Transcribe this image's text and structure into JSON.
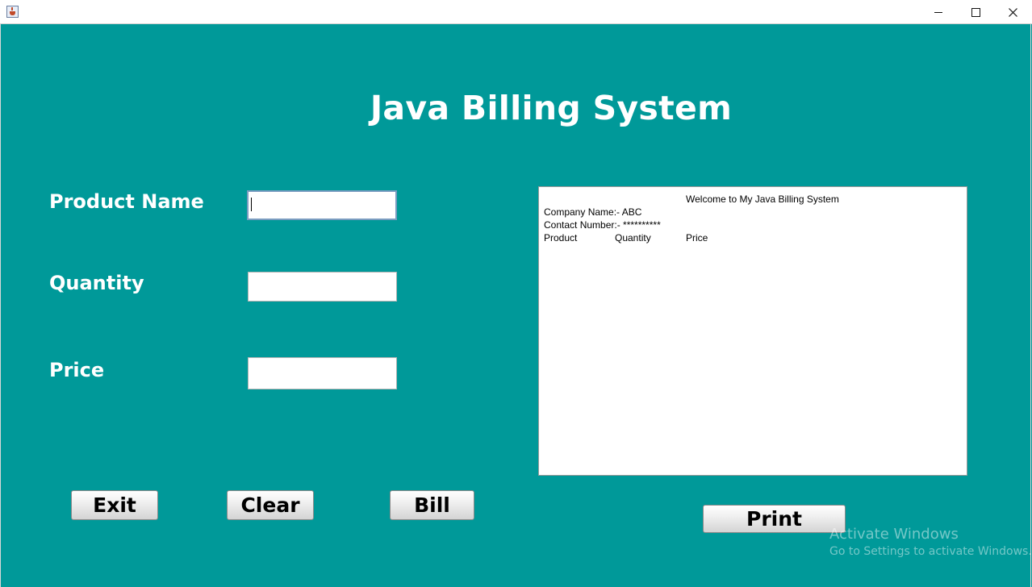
{
  "window": {
    "title": "",
    "controls": {
      "minimize": "minimize-icon",
      "maximize": "maximize-icon",
      "close": "close-icon"
    }
  },
  "heading": "Java Billing System",
  "form": {
    "product_name_label": "Product Name",
    "product_name_value": "",
    "quantity_label": "Quantity",
    "quantity_value": "",
    "price_label": "Price",
    "price_value": ""
  },
  "buttons": {
    "exit": "Exit",
    "clear": "Clear",
    "bill": "Bill",
    "print": "Print"
  },
  "receipt": {
    "welcome": "Welcome to My Java Billing System",
    "company": "Company Name:- ABC",
    "contact": "Contact Number:- **********",
    "col_product": "Product",
    "col_quantity": "Quantity",
    "col_price": "Price"
  },
  "watermark": {
    "line1": "Activate Windows",
    "line2": "Go to Settings to activate Windows."
  },
  "colors": {
    "background": "#009999",
    "text": "#ffffff"
  }
}
